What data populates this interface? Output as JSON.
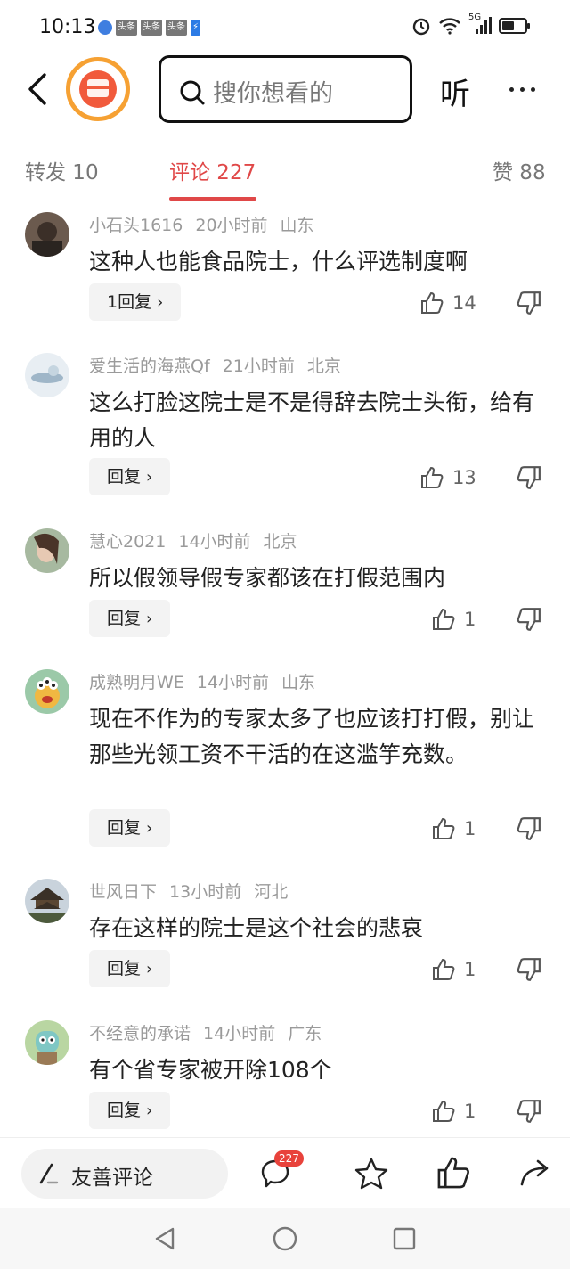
{
  "status_bar": {
    "time": "10:13",
    "app_badges": [
      "头条",
      "头条",
      "头条"
    ],
    "network": "5G",
    "icons": [
      "alarm-icon",
      "wifi-icon",
      "signal-icon",
      "battery-icon"
    ]
  },
  "header": {
    "search_placeholder": "搜你想看的",
    "listen_label": "听",
    "icons": [
      "back-icon",
      "app-logo",
      "search-icon",
      "more-icon"
    ]
  },
  "tabs": {
    "repost": "转发 10",
    "comments": "评论 227",
    "likes": "赞 88"
  },
  "comments": [
    {
      "user": "小石头1616",
      "time": "20小时前",
      "location": "山东",
      "text": "这种人也能食品院士，什么评选制度啊",
      "reply": "1回复",
      "likes": "14"
    },
    {
      "user": "爱生活的海燕Qf",
      "time": "21小时前",
      "location": "北京",
      "text": "这么打脸这院士是不是得辞去院士头衔，给有用的人",
      "reply": "回复",
      "likes": "13"
    },
    {
      "user": "慧心2021",
      "time": "14小时前",
      "location": "北京",
      "text": "所以假领导假专家都该在打假范围内",
      "reply": "回复",
      "likes": "1"
    },
    {
      "user": "成熟明月WE",
      "time": "14小时前",
      "location": "山东",
      "text": "现在不作为的专家太多了也应该打打假，别让那些光领工资不干活的在这滥竽充数。",
      "reply": "回复",
      "likes": "1"
    },
    {
      "user": "世风日下",
      "time": "13小时前",
      "location": "河北",
      "text": "存在这样的院士是这个社会的悲哀",
      "reply": "回复",
      "likes": "1"
    },
    {
      "user": "不经意的承诺",
      "time": "14小时前",
      "location": "广东",
      "text": "有个省专家被开除108个",
      "reply": "回复",
      "likes": "1"
    }
  ],
  "bottom_bar": {
    "input_label": "友善评论",
    "comment_count_badge": "227"
  },
  "colors": {
    "accent_red": "#e04848",
    "meta_gray": "#9a9a9a",
    "logo_orange": "#f6a133"
  }
}
